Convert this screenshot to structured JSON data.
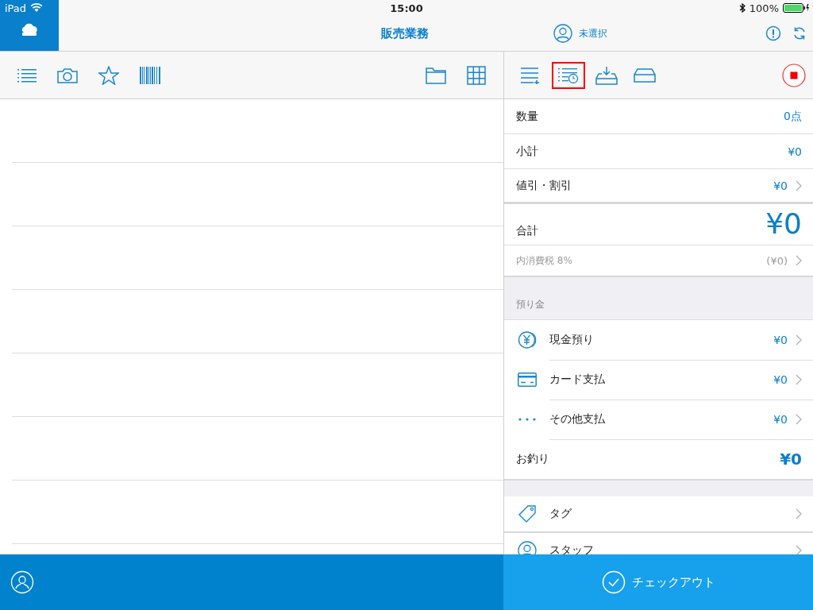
{
  "status_bar": {
    "carrier": "iPad",
    "time": "15:00",
    "battery": "100%"
  },
  "header": {
    "title": "販売業務",
    "customer": "未選択"
  },
  "order_tools": [
    {
      "kind": "add-list",
      "highlighted": false
    },
    {
      "kind": "history",
      "highlighted": true
    },
    {
      "kind": "inbox",
      "highlighted": false
    },
    {
      "kind": "drawer",
      "highlighted": false
    }
  ],
  "summary": [
    {
      "kind": "plain",
      "label": "数量",
      "value": "0点",
      "chevron": false
    },
    {
      "kind": "plain",
      "label": "小計",
      "value": "¥0",
      "chevron": false
    },
    {
      "kind": "plain",
      "label": "値引・割引",
      "value": "¥0",
      "chevron": true
    },
    {
      "kind": "total",
      "label": "合計",
      "value": "¥0",
      "chevron": false
    },
    {
      "kind": "muted",
      "label": "内消費税 8%",
      "value": "(¥0)",
      "chevron": true
    }
  ],
  "deposit": {
    "title": "預り金",
    "payments": [
      {
        "kind": "cash",
        "label": "現金預り",
        "value": "¥0"
      },
      {
        "kind": "card",
        "label": "カード支払",
        "value": "¥0"
      },
      {
        "kind": "other",
        "label": "その他支払",
        "value": "¥0"
      }
    ],
    "change": {
      "label": "お釣り",
      "value": "¥0"
    }
  },
  "extras": [
    {
      "kind": "tag",
      "label": "タグ"
    },
    {
      "kind": "staff",
      "label": "スタッフ"
    }
  ],
  "checkout": {
    "label": "チェックアウト"
  }
}
